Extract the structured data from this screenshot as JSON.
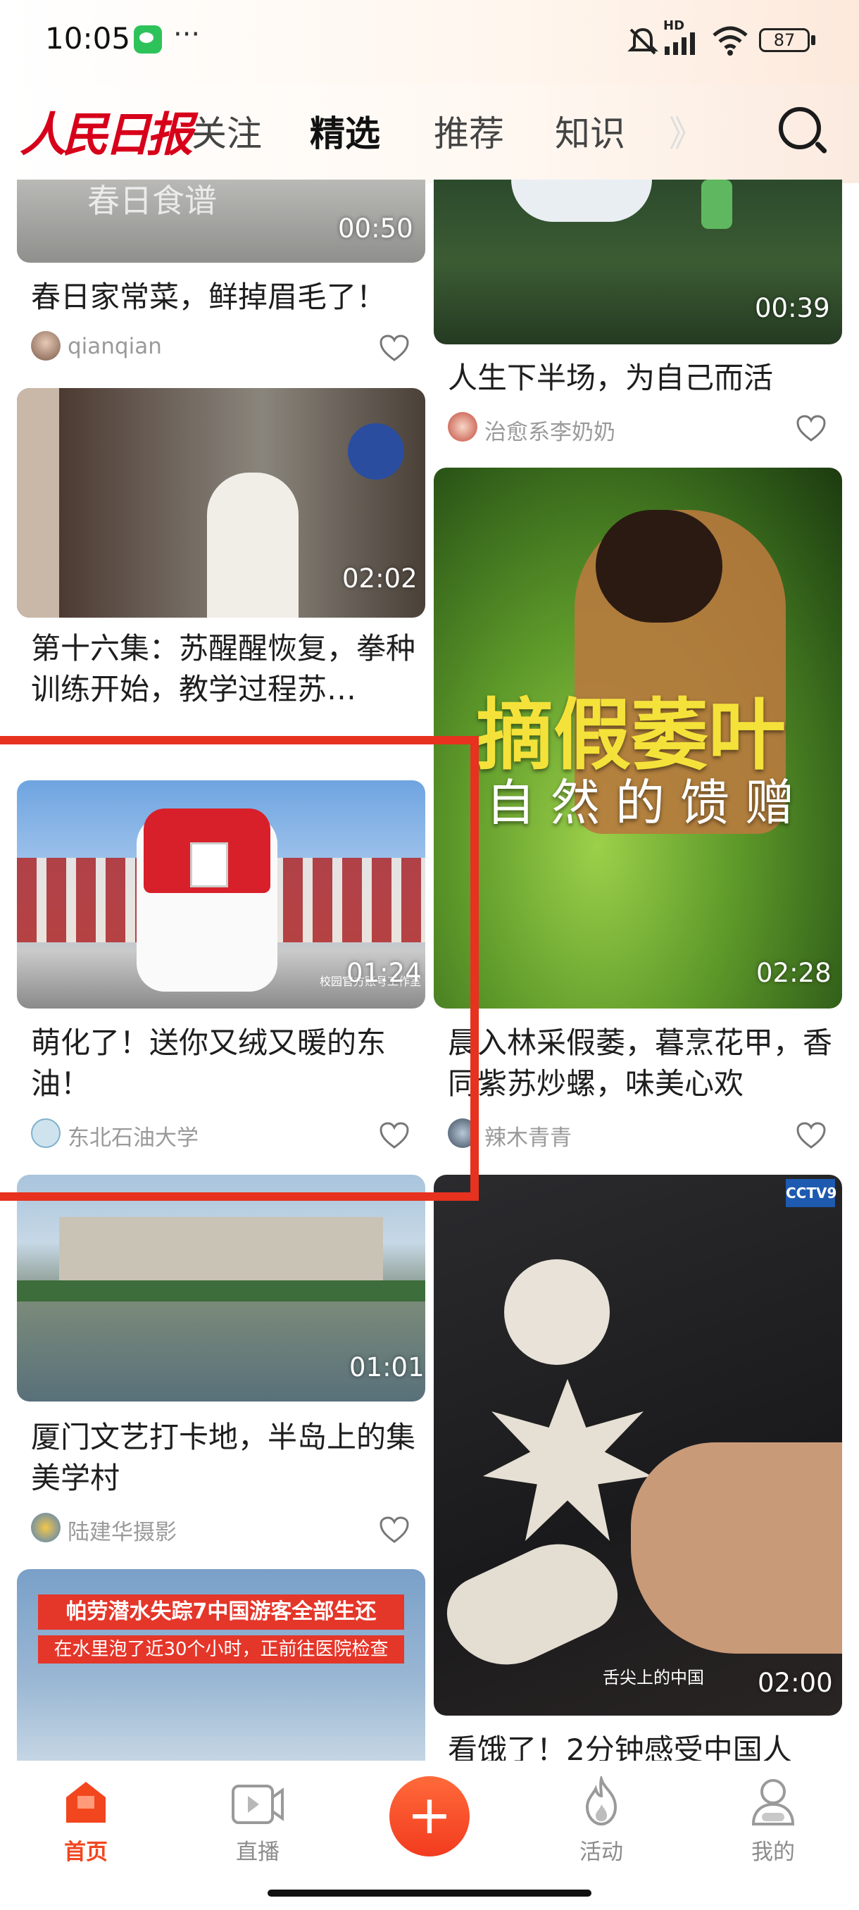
{
  "status_bar": {
    "time": "10:05",
    "dots": "···",
    "hd": "HD",
    "battery": "87"
  },
  "header": {
    "logo": "人民日报",
    "tabs": [
      "关注",
      "精选",
      "推荐",
      "知识",
      "》"
    ],
    "active_tab": "精选"
  },
  "feed": {
    "left": [
      {
        "title": "春日家常菜，鲜掉眉毛了！",
        "author": "qianqian",
        "duration": "00:50",
        "overlay": "春日食谱"
      },
      {
        "title": "第十六集：苏醒醒恢复，拳种训练开始，教学过程苏…",
        "author": "",
        "duration": "02:02"
      },
      {
        "title": "萌化了！送你又绒又暖的东油！",
        "author": "东北石油大学",
        "duration": "01:24",
        "watermark": "校园官方账号工作室"
      },
      {
        "title": "厦门文艺打卡地，半岛上的集美学村",
        "author": "陆建华摄影",
        "duration": "01:01"
      },
      {
        "headline_1": "帕劳潜水失踪7中国游客全部生还",
        "headline_2": "在水里泡了近30个小时，正前往医院检查"
      }
    ],
    "right": [
      {
        "title": "人生下半场，为自己而活",
        "author": "治愈系李奶奶",
        "duration": "00:39"
      },
      {
        "title": "晨入林采假萎，暮烹花甲，香同紫苏炒螺，味美心欢",
        "author": "辣木青青",
        "duration": "02:28",
        "overlay_1": "摘假萎叶",
        "overlay_2": "自然的馈赠"
      },
      {
        "title": "看饿了！2分钟感受中国人",
        "duration": "02:00",
        "channel": "CCTV9",
        "watermark": "舌尖上的中国"
      }
    ]
  },
  "bottom_nav": [
    {
      "label": "首页",
      "icon": "home-icon",
      "active": true
    },
    {
      "label": "直播",
      "icon": "live-tv-icon",
      "active": false
    },
    {
      "label": "",
      "icon": "plus-icon",
      "active": false
    },
    {
      "label": "活动",
      "icon": "flame-icon",
      "active": false
    },
    {
      "label": "我的",
      "icon": "profile-icon",
      "active": false
    }
  ],
  "colors": {
    "brand_red": "#d7001a",
    "accent_orange": "#f2461f",
    "annotation_red": "#e6321e"
  }
}
